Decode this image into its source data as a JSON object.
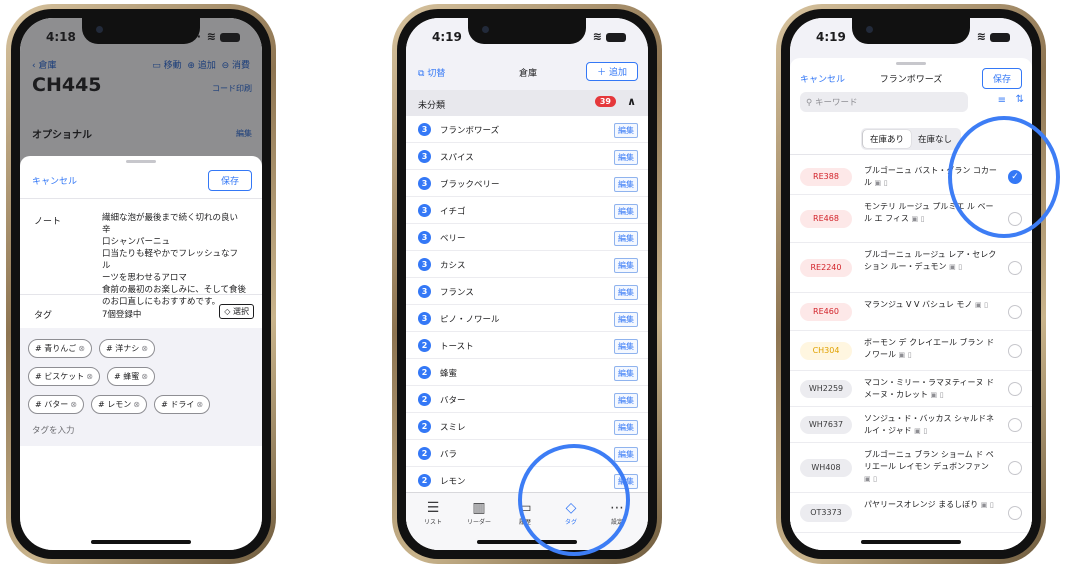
{
  "phone1": {
    "time": "4:18",
    "nav": {
      "back": "倉庫",
      "move": "移動",
      "add": "追加",
      "consume": "消費"
    },
    "title": "CH445",
    "code_print": "コード印刷",
    "optional": "オプショナル",
    "edit": "編集",
    "sheet": {
      "cancel": "キャンセル",
      "save": "保存",
      "note_label": "ノート",
      "note_text": "繊細な泡が最後まで続く切れの良い辛\n口シャンパーニュ\n口当たりも軽やかでフレッシュなフル\nーツを思わせるアロマ\n食前の最初のお楽しみに、そして食後\nのお口直しにもおすすめです。",
      "tag_label": "タグ",
      "tag_count": "7個登録中",
      "select": "選択",
      "tags": [
        "# 青りんご",
        "# 洋ナシ",
        "# ビスケット",
        "# 蜂蜜",
        "# バター",
        "# レモン",
        "# ドライ"
      ],
      "tag_input_placeholder": "タグを入力"
    }
  },
  "phone2": {
    "time": "4:19",
    "nav": {
      "switch": "切替",
      "title": "倉庫",
      "add": "＋ 追加"
    },
    "category": {
      "name": "未分類",
      "badge": "39"
    },
    "edit_label": "編集",
    "rows": [
      {
        "n": "3",
        "name": "フランボワーズ"
      },
      {
        "n": "3",
        "name": "スパイス"
      },
      {
        "n": "3",
        "name": "ブラックベリー"
      },
      {
        "n": "3",
        "name": "イチゴ"
      },
      {
        "n": "3",
        "name": "ベリー"
      },
      {
        "n": "3",
        "name": "カシス"
      },
      {
        "n": "3",
        "name": "フランス"
      },
      {
        "n": "3",
        "name": "ピノ・ノワール"
      },
      {
        "n": "2",
        "name": "トースト"
      },
      {
        "n": "2",
        "name": "蜂蜜"
      },
      {
        "n": "2",
        "name": "バター"
      },
      {
        "n": "2",
        "name": "スミレ"
      },
      {
        "n": "2",
        "name": "バラ"
      },
      {
        "n": "2",
        "name": "レモン"
      }
    ],
    "tabs": [
      {
        "label": "リスト",
        "icon": "list-icon"
      },
      {
        "label": "リーダー",
        "icon": "barcode-icon"
      },
      {
        "label": "履歴",
        "icon": "history-icon"
      },
      {
        "label": "タグ",
        "icon": "tag-icon"
      },
      {
        "label": "設定",
        "icon": "more-icon"
      }
    ]
  },
  "phone3": {
    "time": "4:19",
    "cancel": "キャンセル",
    "title": "フランボワーズ",
    "save": "保存",
    "search_placeholder": "キーワード",
    "segment": [
      "在庫あり",
      "在庫なし"
    ],
    "items": [
      {
        "code": "RE388",
        "color": "red",
        "name": "ブルゴーニュ バスト・グラン コカール",
        "checked": true
      },
      {
        "code": "RE468",
        "color": "red",
        "name": "モンテリ ルージュ プルミエ ル ベール エ フィス",
        "checked": false
      },
      {
        "code": "RE2240",
        "color": "red",
        "name": "ブルゴーニュ ルージュ レア・セレクション ルー・デュモン",
        "checked": false
      },
      {
        "code": "RE460",
        "color": "red",
        "name": "マランジュ V V バシュレ モノ",
        "checked": false
      },
      {
        "code": "CH304",
        "color": "yel",
        "name": "ボーモン デ クレイエール ブラン ド ノワール",
        "checked": false
      },
      {
        "code": "WH2259",
        "color": "gray",
        "name": "マコン・ミリー・ラマヌティーヌ ドメーヌ・カレット",
        "checked": false
      },
      {
        "code": "WH7637",
        "color": "gray",
        "name": "ソンジュ・ド・バッカス シャルドネ ルイ・ジャド",
        "checked": false
      },
      {
        "code": "WH408",
        "color": "gray",
        "name": "ブルゴーニュ ブラン ショーム ド ペリエール レイモン デュボンファン",
        "checked": false
      },
      {
        "code": "OT3373",
        "color": "gray",
        "name": "パヤリースオレンジ まるしぼり",
        "checked": false
      }
    ]
  }
}
